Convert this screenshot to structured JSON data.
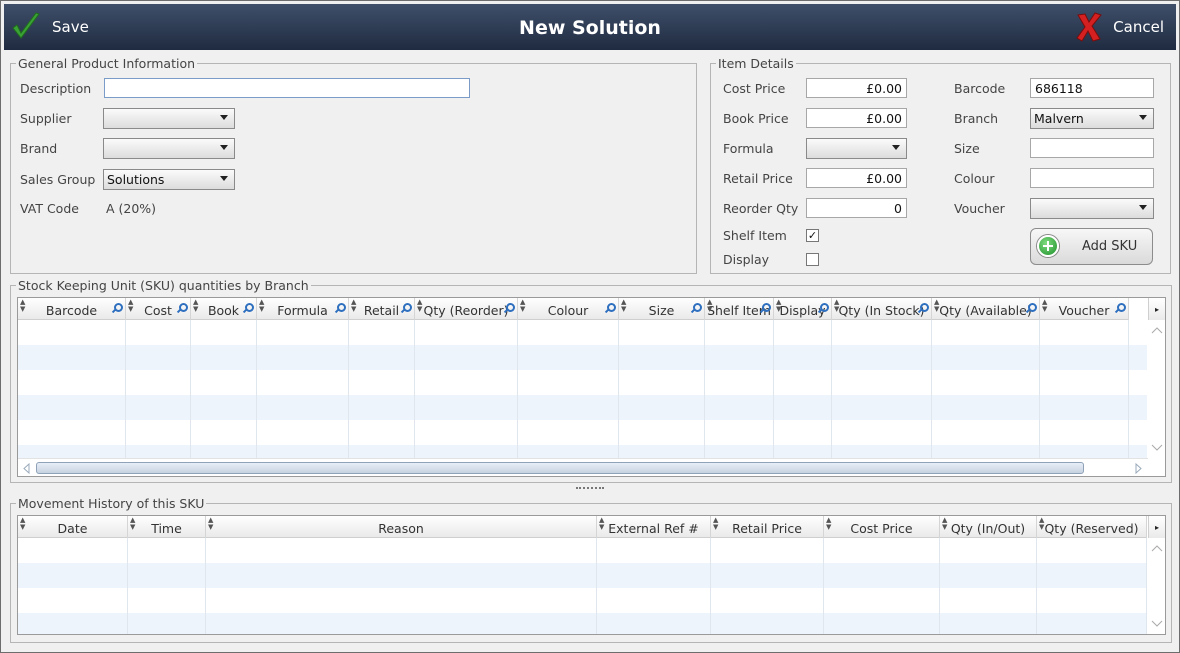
{
  "window": {
    "title": "New Solution",
    "save_label": "Save",
    "cancel_label": "Cancel",
    "colors": {
      "titlebar": "#2a3650",
      "save_check": "#3aa235",
      "cancel_x": "#d42020"
    }
  },
  "general": {
    "legend": "General Product Information",
    "description_label": "Description",
    "description_value": "",
    "supplier_label": "Supplier",
    "supplier_value": "",
    "brand_label": "Brand",
    "brand_value": "",
    "sales_group_label": "Sales Group",
    "sales_group_value": "Solutions",
    "vat_label": "VAT Code",
    "vat_value": "A (20%)"
  },
  "item": {
    "legend": "Item Details",
    "cost_price_label": "Cost Price",
    "cost_price_value": "£0.00",
    "book_price_label": "Book Price",
    "book_price_value": "£0.00",
    "formula_label": "Formula",
    "formula_value": "",
    "retail_price_label": "Retail Price",
    "retail_price_value": "£0.00",
    "reorder_qty_label": "Reorder Qty",
    "reorder_qty_value": "0",
    "shelf_item_label": "Shelf Item",
    "shelf_item_checked": true,
    "display_label": "Display",
    "display_checked": false,
    "barcode_label": "Barcode",
    "barcode_value": "686118",
    "branch_label": "Branch",
    "branch_value": "Malvern",
    "size_label": "Size",
    "size_value": "",
    "colour_label": "Colour",
    "colour_value": "",
    "voucher_label": "Voucher",
    "voucher_value": "",
    "add_sku_label": "Add SKU"
  },
  "sku_grid": {
    "legend": "Stock Keeping Unit (SKU) quantities by Branch",
    "columns": [
      "Barcode",
      "Cost",
      "Book",
      "Formula",
      "Retail",
      "Qty (Reorder)",
      "Colour",
      "Size",
      "Shelf Item",
      "Display",
      "Qty (In Stock)",
      "Qty (Available)",
      "Voucher"
    ],
    "rows": []
  },
  "history_grid": {
    "legend": "Movement History of this SKU",
    "columns": [
      "Date",
      "Time",
      "Reason",
      "External Ref #",
      "Retail Price",
      "Cost Price",
      "Qty (In/Out)",
      "Qty (Reserved)"
    ],
    "rows": []
  }
}
